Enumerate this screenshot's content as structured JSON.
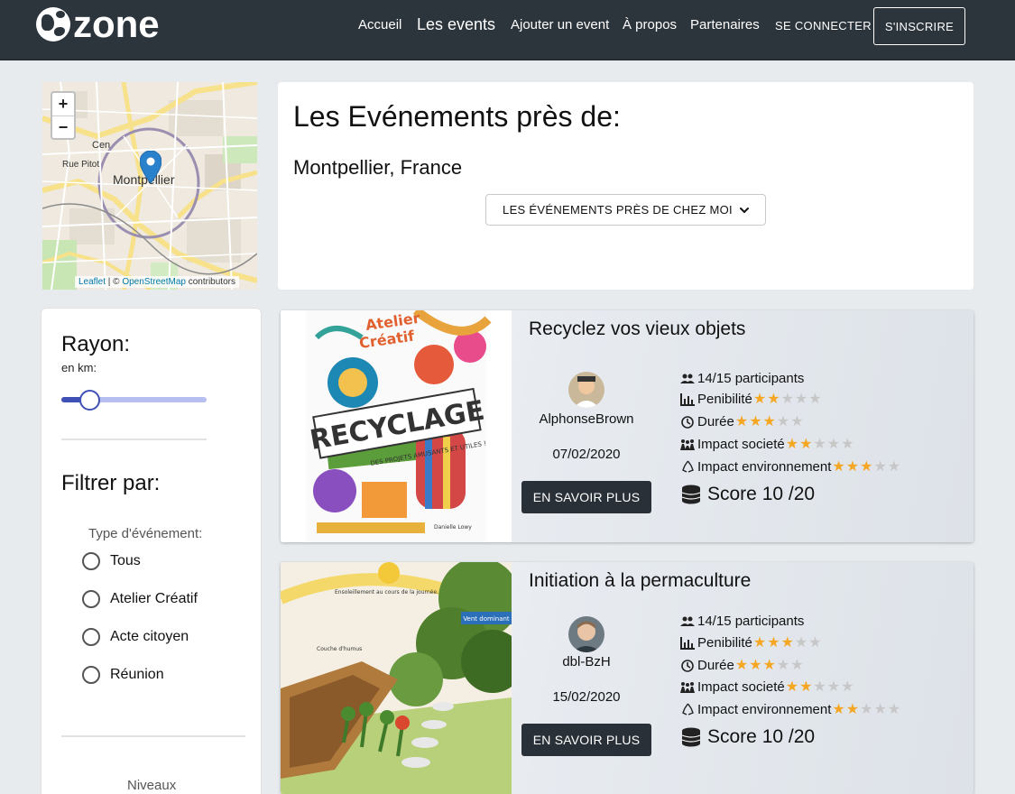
{
  "brand": {
    "name": "zone"
  },
  "nav": {
    "accueil": "Accueil",
    "events": "Les events",
    "ajouter": "Ajouter un event",
    "apropos": "À propos",
    "partenaires": "Partenaires",
    "connexion": "SE CONNECTER",
    "inscription": "S'INSCRIRE"
  },
  "map": {
    "zoom_in": "+",
    "zoom_out": "−",
    "labels": {
      "cen": "Cen",
      "rue_pitot": "Rue Pitot",
      "montpellier": "Montpellier"
    },
    "attribution": {
      "leaflet": "Leaflet",
      "sep": " | © ",
      "osm": "OpenStreetMap",
      "contrib": " contributors"
    }
  },
  "header": {
    "title": "Les Evénements près de:",
    "city": "Montpellier, France",
    "dropdown": "LES ÉVÉNEMENTS PRÈS DE CHEZ MOI"
  },
  "filters": {
    "rayon_title": "Rayon:",
    "rayon_unit": "en km:",
    "rayon_slider_fraction": 0.2,
    "filter_title": "Filtrer par:",
    "type_label": "Type d'événement:",
    "types": [
      "Tous",
      "Atelier Créatif",
      "Acte citoyen",
      "Réunion"
    ],
    "niveaux_label": "Niveaux"
  },
  "events": [
    {
      "title": "Recyclez vos vieux objets",
      "author": "AlphonseBrown",
      "date": "07/02/2020",
      "button": "EN SAVOIR PLUS",
      "participants": "14/15 participants",
      "penibilite_label": "Penibilité",
      "penibilite": 2,
      "duree_label": "Durée",
      "duree": 3,
      "impact_societe_label": "Impact societé",
      "impact_societe": 2,
      "impact_env_label": "Impact environnement",
      "impact_env": 3,
      "score": "Score 10 /20",
      "image_text": {
        "atelier": "Atelier",
        "creatif": "Créatif",
        "big": "RECYCLAGE",
        "sub": "DES PROJETS AMUSANTS ET UTILES !",
        "author": "Danielle Lowy"
      }
    },
    {
      "title": "Initiation à la permaculture",
      "author": "dbl-BzH",
      "date": "15/02/2020",
      "button": "EN SAVOIR PLUS",
      "participants": "14/15 participants",
      "penibilite_label": "Penibilité",
      "penibilite": 3,
      "duree_label": "Durée",
      "duree": 3,
      "impact_societe_label": "Impact societé",
      "impact_societe": 2,
      "impact_env_label": "Impact environnement",
      "impact_env": 2,
      "score": "Score 10 /20",
      "image_text": {
        "ensoleillement": "Ensoleillement au cours de la journée.",
        "vent": "Vent dominant",
        "couche": "Couche d'humus"
      }
    }
  ],
  "colors": {
    "topbar": "#2c343c",
    "accent": "#3f51b5",
    "star": "#f5a623",
    "button": "#2a3038"
  }
}
